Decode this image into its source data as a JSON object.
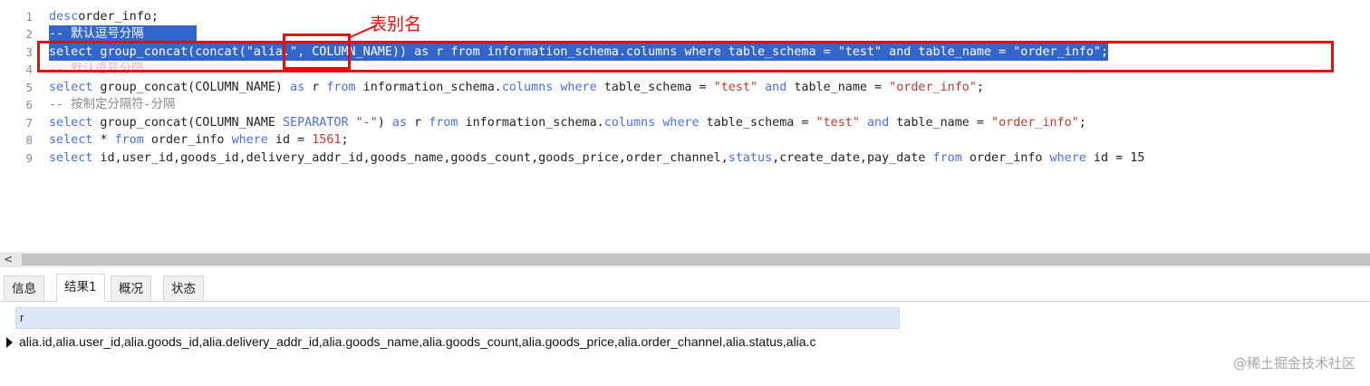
{
  "editor": {
    "lines": [
      {
        "n": "1",
        "parts": [
          [
            "kw",
            "desc"
          ],
          [
            "",
            "order_info;"
          ]
        ]
      },
      {
        "n": "2",
        "parts": [
          [
            "cm",
            "-- 默认逗号分隔"
          ]
        ]
      },
      {
        "n": "3",
        "parts": [
          [
            "kw",
            "select"
          ],
          [
            "",
            " group_concat(concat("
          ],
          [
            "str",
            "\"alia.\""
          ],
          [
            "",
            ", COLUMN_NAME)) "
          ],
          [
            "kw",
            "as"
          ],
          [
            "",
            " r "
          ],
          [
            "kw",
            "from"
          ],
          [
            "",
            " information_schema."
          ],
          [
            "kw",
            "columns"
          ],
          [
            "",
            ""
          ],
          [
            "kw",
            " where"
          ],
          [
            "",
            " table_schema = "
          ],
          [
            "str",
            "\"test\""
          ],
          [
            "",
            ""
          ],
          [
            "kw",
            " and"
          ],
          [
            "",
            " table_name = "
          ],
          [
            "str",
            "\"order_info\""
          ],
          [
            "",
            ";"
          ]
        ]
      },
      {
        "n": "4",
        "parts": [
          [
            "cm",
            "-- 默认逗号分隔"
          ]
        ]
      },
      {
        "n": "5",
        "parts": [
          [
            "kw",
            "select"
          ],
          [
            "",
            " group_concat(COLUMN_NAME) "
          ],
          [
            "kw",
            "as"
          ],
          [
            "",
            " r "
          ],
          [
            "kw",
            "from"
          ],
          [
            "",
            " information_schema."
          ],
          [
            "kw",
            "columns"
          ],
          [
            "kw",
            " where"
          ],
          [
            "",
            " table_schema = "
          ],
          [
            "str",
            "\"test\""
          ],
          [
            "kw",
            " and"
          ],
          [
            "",
            " table_name = "
          ],
          [
            "str",
            "\"order_info\""
          ],
          [
            "",
            ";"
          ]
        ]
      },
      {
        "n": "6",
        "parts": [
          [
            "cm",
            "-- 按制定分隔符-分隔"
          ]
        ]
      },
      {
        "n": "7",
        "parts": [
          [
            "kw",
            "select"
          ],
          [
            "",
            " group_concat(COLUMN_NAME "
          ],
          [
            "kw",
            "SEPARATOR"
          ],
          [
            "str",
            " \"-\""
          ],
          [
            "",
            ") "
          ],
          [
            "kw",
            "as"
          ],
          [
            "",
            " r "
          ],
          [
            "kw",
            "from"
          ],
          [
            "",
            " information_schema."
          ],
          [
            "kw",
            "columns"
          ],
          [
            "kw",
            " where"
          ],
          [
            "",
            " table_schema = "
          ],
          [
            "str",
            "\"test\""
          ],
          [
            "kw",
            " and"
          ],
          [
            "",
            " table_name = "
          ],
          [
            "str",
            "\"order_info\""
          ],
          [
            "",
            ";"
          ]
        ]
      },
      {
        "n": "8",
        "parts": [
          [
            "kw",
            "select"
          ],
          [
            "",
            " * "
          ],
          [
            "kw",
            "from"
          ],
          [
            "",
            " order_info "
          ],
          [
            "kw",
            "where"
          ],
          [
            "",
            " id = "
          ],
          [
            "num",
            "1561"
          ],
          [
            "",
            ";"
          ]
        ]
      },
      {
        "n": "9",
        "parts": [
          [
            "kw",
            "select"
          ],
          [
            "",
            " id,user_id,goods_id,delivery_addr_id,goods_name,goods_count,goods_price,order_channel,"
          ],
          [
            "kw",
            "status"
          ],
          [
            "",
            ",create_date,pay_date "
          ],
          [
            "kw",
            "from"
          ],
          [
            "",
            " order_info "
          ],
          [
            "kw",
            "where"
          ],
          [
            "",
            " id = 15"
          ]
        ]
      }
    ]
  },
  "annotation": {
    "label": "表别名",
    "color": "#e41010"
  },
  "scrollbar": {
    "left_arrow": "<"
  },
  "tabs": [
    "信息",
    "结果1",
    "概况",
    "状态"
  ],
  "active_tab": "结果1",
  "result": {
    "column": "r",
    "rows": [
      "alia.id,alia.user_id,alia.goods_id,alia.delivery_addr_id,alia.goods_name,alia.goods_count,alia.goods_price,alia.order_channel,alia.status,alia.c"
    ]
  },
  "watermark": "@稀土掘金技术社区"
}
